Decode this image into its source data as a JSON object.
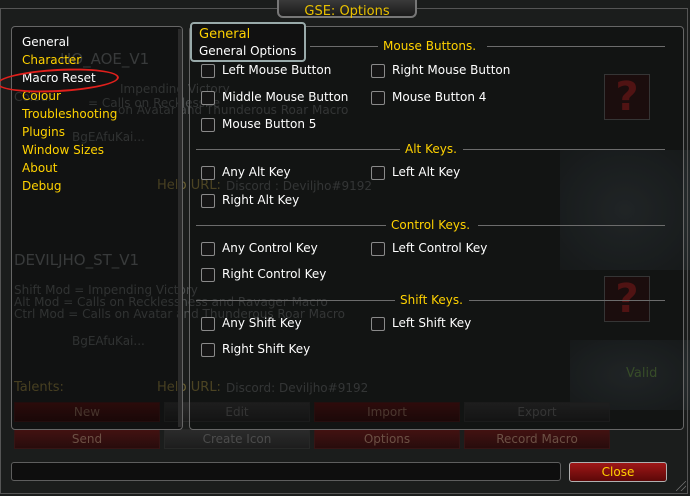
{
  "window": {
    "title": "GSE: Options",
    "close_label": "Close"
  },
  "tree": {
    "items": [
      {
        "label": "General"
      },
      {
        "label": "Character"
      },
      {
        "label": "Macro Reset"
      },
      {
        "label": "Colour"
      },
      {
        "label": "Troubleshooting"
      },
      {
        "label": "Plugins"
      },
      {
        "label": "Window Sizes"
      },
      {
        "label": "About"
      },
      {
        "label": "Debug"
      }
    ]
  },
  "group_tab": {
    "title": "General",
    "subtitle": "General Options"
  },
  "sections": {
    "mouse": {
      "header": "Mouse Buttons.",
      "options": [
        "Left Mouse Button",
        "Right Mouse Button",
        "Middle Mouse Button",
        "Mouse Button 4",
        "Mouse Button 5"
      ]
    },
    "alt": {
      "header": "Alt Keys.",
      "options": [
        "Any Alt Key",
        "Left Alt Key",
        "Right Alt Key"
      ]
    },
    "control": {
      "header": "Control Keys.",
      "options": [
        "Any Control Key",
        "Left Control Key",
        "Right Control Key"
      ]
    },
    "shift": {
      "header": "Shift Keys.",
      "options": [
        "Any Shift Key",
        "Left Shift Key",
        "Right Shift Key"
      ]
    }
  },
  "background": {
    "macro1_name": "DEVILJHO_AOE_V1",
    "macro1_fragment": "HO_AOE_V1",
    "colour_ghost": "Colour",
    "line_victory": "Impending Victory",
    "line_calls": "= Calls on Recklessne",
    "line_avatar": "on Avatar and Thunderous Roar Macro",
    "code1": "BgEAfuKai...",
    "help_label": "Help URL:",
    "help_url1": "Discord : Deviljho#9192",
    "macro2_name": "DEVILJHO_ST_V1",
    "shift_mod": "Shift Mod = Impending Victory",
    "alt_mod": "Alt Mod = Calls on Recklessness and Ravager Macro",
    "ctrl_mod": "Ctrl Mod = Calls on Avatar and Thunderous Roar Macro",
    "code2": "BgEAfuKai...",
    "talents_label": "Talents:",
    "help_url2": "Discord: Deviljho#9192",
    "valid_fragment": "Valid",
    "buttons": {
      "new": "New",
      "edit": "Edit",
      "import": "Import",
      "export": "Export",
      "send": "Send",
      "create_icon": "Create Icon",
      "options": "Options",
      "record_macro": "Record Macro"
    }
  },
  "colors": {
    "gold": "#ffd200",
    "close_button": "#a01818",
    "annotation_ring": "#e0201c"
  },
  "icons": {
    "question_mark": "question-mark-icon"
  }
}
